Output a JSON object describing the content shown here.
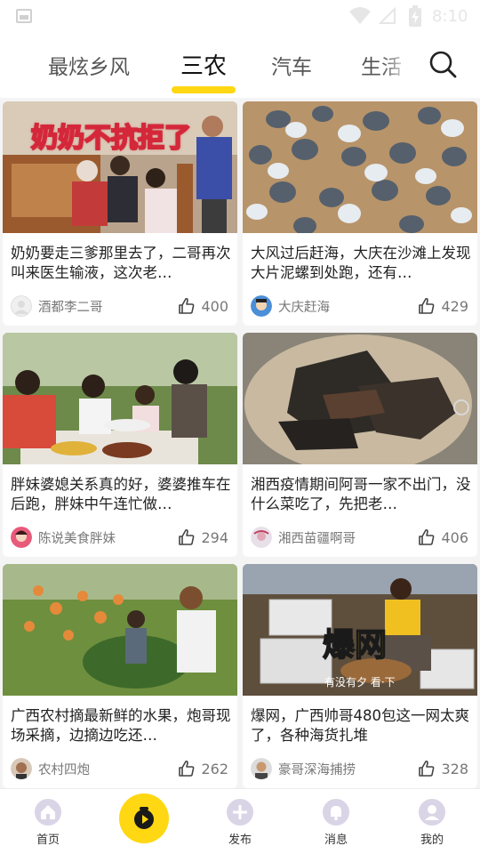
{
  "status_bar": {
    "time": "8:10"
  },
  "tabs": [
    {
      "label": "最炫乡风",
      "active": false
    },
    {
      "label": "三农",
      "active": true
    },
    {
      "label": "汽车",
      "active": false
    },
    {
      "label": "生活",
      "active": false
    }
  ],
  "colors": {
    "accent": "#ffd712",
    "text": "#222222",
    "muted": "#777777"
  },
  "cards": [
    {
      "thumb_caption": "奶奶不抗拒了",
      "title": "奶奶要走三爹那里去了，二哥再次叫来医生输液，这次老…",
      "author": "酒都李二哥",
      "likes": "400"
    },
    {
      "thumb_caption": "",
      "title": "大风过后赶海，大庆在沙滩上发现大片泥螺到处跑，还有…",
      "author": "大庆赶海",
      "likes": "429"
    },
    {
      "thumb_caption": "",
      "title": "胖妹婆媳关系真的好，婆婆推车在后跑，胖妹中午连忙做…",
      "author": "陈说美食胖妹",
      "likes": "294"
    },
    {
      "thumb_caption": "",
      "title": "湘西疫情期间阿哥一家不出门，没什么菜吃了，先把老…",
      "author": "湘西苗疆啊哥",
      "likes": "406"
    },
    {
      "thumb_caption": "",
      "title": "广西农村摘最新鲜的水果，炮哥现场采摘，边摘边吃还…",
      "author": "农村四炮",
      "likes": "262"
    },
    {
      "thumb_caption": "爆网",
      "thumb_subcaption": "有没有夕 看·下",
      "title": "爆网，广西帅哥480包这一网太爽了，各种海货扎堆",
      "author": "豪哥深海捕捞",
      "likes": "328"
    }
  ],
  "bottom_nav": [
    {
      "label": "首页",
      "icon": "home-icon"
    },
    {
      "label": "",
      "icon": "camera-icon"
    },
    {
      "label": "发布",
      "icon": "plus-icon"
    },
    {
      "label": "消息",
      "icon": "bell-icon"
    },
    {
      "label": "我的",
      "icon": "profile-icon"
    }
  ]
}
